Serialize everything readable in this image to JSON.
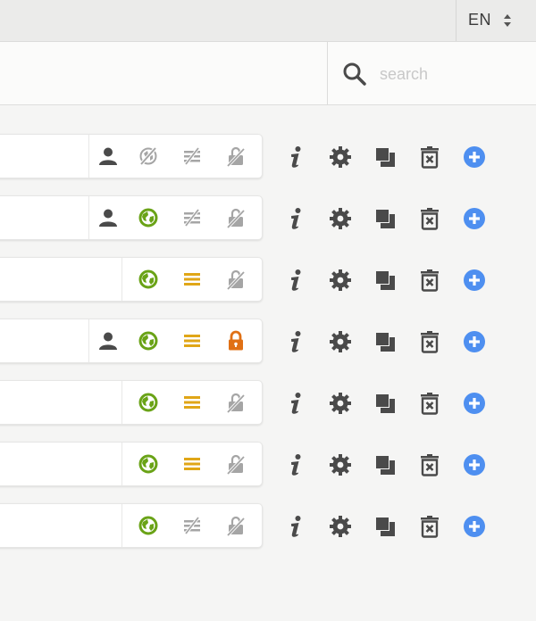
{
  "header": {
    "language": "EN"
  },
  "search": {
    "placeholder": "search",
    "value": ""
  },
  "colors": {
    "green": "#6aa317",
    "yellow": "#e0a617",
    "orange": "#e07015",
    "blue": "#4e8ff0",
    "dark": "#4a4a4a",
    "muted": "#a5a5a5"
  },
  "rows": [
    {
      "user": true,
      "globe": "hidden",
      "menu": "inactive",
      "lock": "unlocked"
    },
    {
      "user": true,
      "globe": "visible",
      "menu": "inactive",
      "lock": "unlocked"
    },
    {
      "user": false,
      "globe": "visible",
      "menu": "active",
      "lock": "unlocked"
    },
    {
      "user": true,
      "globe": "visible",
      "menu": "active",
      "lock": "locked"
    },
    {
      "user": false,
      "globe": "visible",
      "menu": "active",
      "lock": "unlocked"
    },
    {
      "user": false,
      "globe": "visible",
      "menu": "active",
      "lock": "unlocked"
    },
    {
      "user": false,
      "globe": "visible",
      "menu": "inactive",
      "lock": "unlocked"
    }
  ],
  "row_actions": [
    "info-icon",
    "settings-gear-icon",
    "duplicate-icon",
    "delete-trash-icon",
    "add-plus-icon"
  ]
}
